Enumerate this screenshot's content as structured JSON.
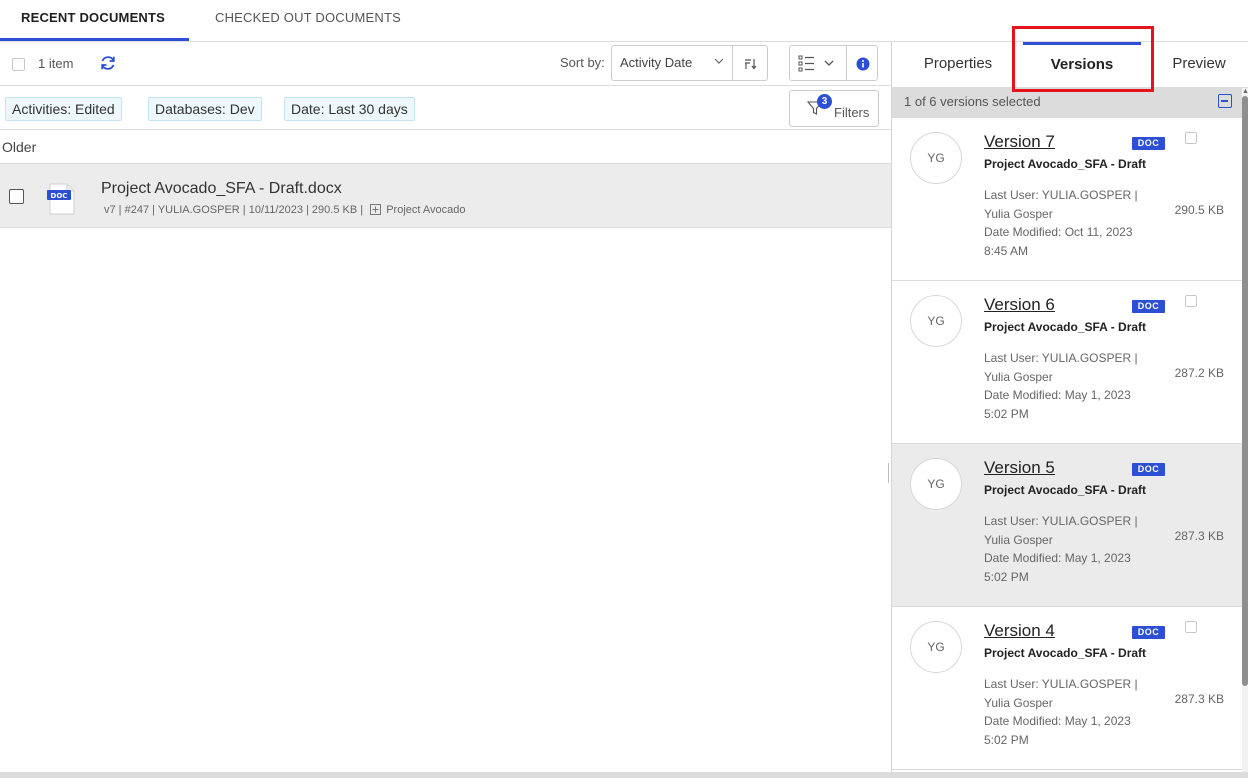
{
  "top_tabs": {
    "recent": "RECENT DOCUMENTS",
    "checked_out": "CHECKED OUT DOCUMENTS"
  },
  "toolbar": {
    "item_count": "1 item",
    "sort_label": "Sort by:",
    "sort_value": "Activity Date"
  },
  "filters": {
    "chips": [
      "Activities: Edited",
      "Databases: Dev",
      "Date: Last 30 days"
    ],
    "button_label": "Filters",
    "count": "3"
  },
  "list": {
    "group": "Older",
    "document": {
      "title": "Project Avocado_SFA - Draft.docx",
      "meta": "v7 | #247 | YULIA.GOSPER | 10/11/2023 | 290.5 KB |",
      "workspace": "Project Avocado",
      "badge": "DOC"
    }
  },
  "right_panel": {
    "tabs": [
      "Properties",
      "Versions",
      "Preview"
    ],
    "active_tab": "Versions",
    "selection_text": "1 of 6 versions selected",
    "versions": [
      {
        "title": "Version 7",
        "initials": "YG",
        "name": "Project Avocado_SFA - Draft",
        "user_line1": "Last User: YULIA.GOSPER |",
        "user_line2": "Yulia Gosper",
        "date_line1": "Date Modified: Oct 11, 2023",
        "date_line2": "8:45 AM",
        "size": "290.5 KB",
        "badge": "DOC"
      },
      {
        "title": "Version 6",
        "initials": "YG",
        "name": "Project Avocado_SFA - Draft",
        "user_line1": "Last User: YULIA.GOSPER |",
        "user_line2": "Yulia Gosper",
        "date_line1": "Date Modified: May 1, 2023",
        "date_line2": "5:02 PM",
        "size": "287.2 KB",
        "badge": "DOC"
      },
      {
        "title": "Version 5",
        "initials": "YG",
        "name": "Project Avocado_SFA - Draft",
        "user_line1": "Last User: YULIA.GOSPER |",
        "user_line2": "Yulia Gosper",
        "date_line1": "Date Modified: May 1, 2023",
        "date_line2": "5:02 PM",
        "size": "287.3 KB",
        "badge": "DOC"
      },
      {
        "title": "Version 4",
        "initials": "YG",
        "name": "Project Avocado_SFA - Draft",
        "user_line1": "Last User: YULIA.GOSPER |",
        "user_line2": "Yulia Gosper",
        "date_line1": "Date Modified: May 1, 2023",
        "date_line2": "5:02 PM",
        "size": "287.3 KB",
        "badge": "DOC"
      }
    ]
  },
  "colors": {
    "accent": "#2c4fd4",
    "highlight": "#e3141d",
    "chip_bg": "#eef7fb",
    "selected_row": "#ececec"
  },
  "icons": [
    "refresh-icon",
    "sort-direction-icon",
    "list-view-icon",
    "chevron-down-icon",
    "info-icon",
    "filter-icon",
    "doc-file-icon",
    "workspace-icon",
    "collapse-icon"
  ]
}
